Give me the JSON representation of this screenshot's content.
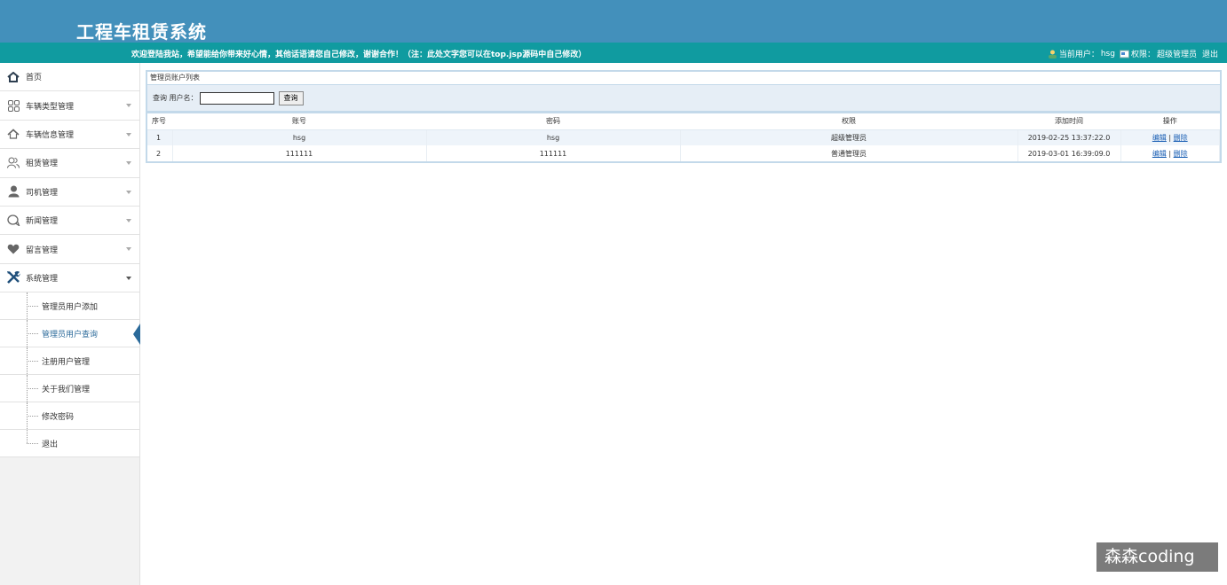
{
  "header": {
    "app_title": "工程车租赁系统",
    "welcome": "欢迎登陆我站，希望能给你带来好心情，其他话语请您自己修改，谢谢合作！（注：此处文字您可以在top.jsp源码中自己修改）",
    "current_user_label": "当前用户：",
    "current_user": "hsg",
    "role_label": "权限：",
    "role": "超级管理员",
    "logout": "退出"
  },
  "sidebar": {
    "items": [
      {
        "label": "首页",
        "icon": "home-icon"
      },
      {
        "label": "车辆类型管理",
        "icon": "grid-icon"
      },
      {
        "label": "车辆信息管理",
        "icon": "home-icon"
      },
      {
        "label": "租赁管理",
        "icon": "users-icon"
      },
      {
        "label": "司机管理",
        "icon": "user-icon"
      },
      {
        "label": "新闻管理",
        "icon": "chat-icon"
      },
      {
        "label": "留言管理",
        "icon": "heart-icon"
      },
      {
        "label": "系统管理",
        "icon": "tools-icon"
      }
    ],
    "submenu": [
      {
        "label": "管理员用户添加"
      },
      {
        "label": "管理员用户查询"
      },
      {
        "label": "注册用户管理"
      },
      {
        "label": "关于我们管理"
      },
      {
        "label": "修改密码"
      },
      {
        "label": "退出"
      }
    ]
  },
  "main": {
    "panel_title": "管理员账户列表",
    "search_label": "查询 用户名：",
    "search_value": "",
    "search_button": "查询",
    "columns": [
      "序号",
      "账号",
      "密码",
      "权限",
      "添加时间",
      "操作"
    ],
    "rows": [
      {
        "idx": "1",
        "account": "hsg",
        "password": "hsg",
        "role": "超级管理员",
        "time": "2019-02-25 13:37:22.0",
        "edit": "编辑",
        "sep": "|",
        "del": "删除"
      },
      {
        "idx": "2",
        "account": "111111",
        "password": "111111",
        "role": "普通管理员",
        "time": "2019-03-01 16:39:09.0",
        "edit": "编辑",
        "sep": "|",
        "del": "删除"
      }
    ]
  },
  "watermark": "森森coding",
  "colors": {
    "topbar": "#4390bb",
    "welcome_bar": "#109ba0",
    "active_pointer": "#2b6a9a",
    "link": "#1a5fb4"
  }
}
